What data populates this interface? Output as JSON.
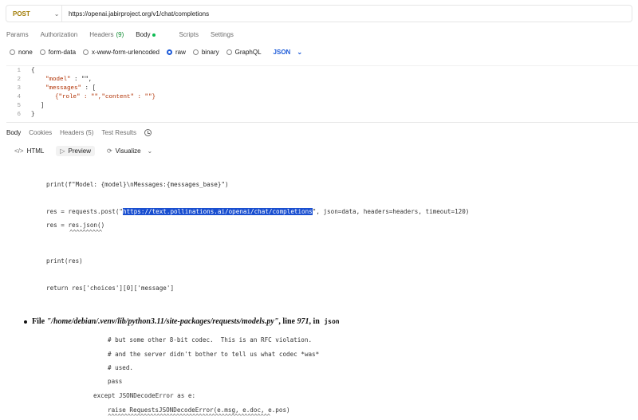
{
  "request": {
    "method": "POST",
    "url": "https://openai.jabirproject.org/v1/chat/completions"
  },
  "request_tabs": [
    {
      "label": "Params"
    },
    {
      "label": "Authorization"
    },
    {
      "label": "Headers",
      "count": "(9)"
    },
    {
      "label": "Body",
      "active": true
    },
    {
      "label": "Scripts"
    },
    {
      "label": "Settings"
    }
  ],
  "body_types": [
    "none",
    "form-data",
    "x-www-form-urlencoded",
    "raw",
    "binary",
    "GraphQL"
  ],
  "body_type_selected": "raw",
  "body_format": "JSON",
  "editor": {
    "lines": [
      "1",
      "2",
      "3",
      "4",
      "5",
      "6"
    ],
    "l1": "{",
    "l2_key": "\"model\"",
    "l2_rest": " : \"\",",
    "l3_key": "\"messages\"",
    "l3_rest": " : [",
    "l4": "    {\"role\" : \"\",\"content\" : \"\"}",
    "l5": "]",
    "l6": "}"
  },
  "response_tabs": [
    {
      "label": "Body",
      "active": true
    },
    {
      "label": "Cookies"
    },
    {
      "label": "Headers (5)"
    },
    {
      "label": "Test Results"
    }
  ],
  "view_modes": [
    {
      "label": "HTML",
      "icon": "code-icon"
    },
    {
      "label": "Preview",
      "icon": "play-icon",
      "selected": true
    },
    {
      "label": "Visualize",
      "icon": "visualize-icon"
    }
  ],
  "preview": {
    "print_line": "print(f\"Model: {model}\\nMessages:{messages_base}\")",
    "res_prefix": "res = requests.post(\"",
    "res_url": "https://text.pollinations.ai/openai/chat/completions",
    "res_suffix": "\", json=data, headers=headers, timeout=120)",
    "res_json": "res = res.json()",
    "carets1": "^^^^^^^^^^",
    "print_res": "print(res)",
    "return_line": "return res['choices'][0]['message']",
    "file_prefix": "File ",
    "file_path": "\"/home/debian/.venv/lib/python3.11/site-packages/requests/models.py\"",
    "file_mid": ", line ",
    "file_line_no": "971",
    "file_in": ", in ",
    "file_func": "json",
    "c1": "# but some other 8-bit codec.  This is an RFC violation.",
    "c2": "# and the server didn't bother to tell us what codec *was*",
    "c3": "# used.",
    "pass": "pass",
    "except_line": "except JSONDecodeError as e:",
    "raise_line": "raise RequestsJSONDecodeError(e.msg, e.doc, e.pos)",
    "carets2": "^^^^^^^^^^^^^^^^^^^^^^^^^^^^^^^^^^^^^^^^^^^^^^^^^^"
  },
  "colors": {
    "method": "#a07a00",
    "accent": "#1d5bd8",
    "highlight": "#1a4fd0",
    "active_dot": "#0cbb52"
  }
}
